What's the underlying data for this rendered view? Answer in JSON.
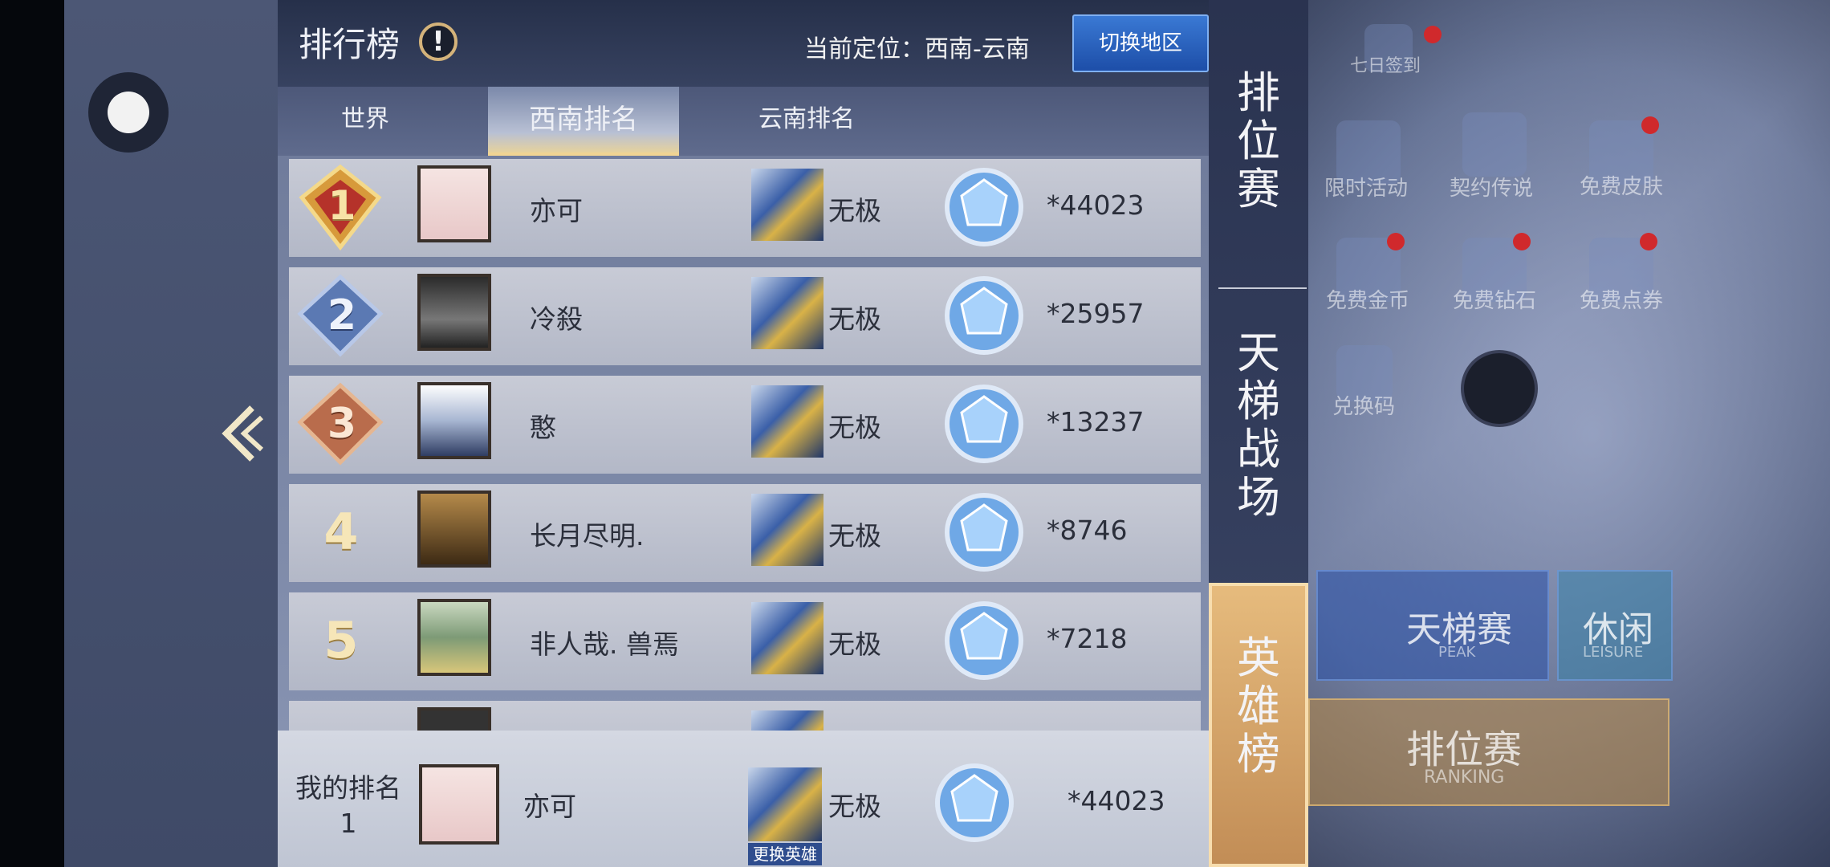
{
  "header": {
    "title": "排行榜",
    "location": "当前定位：西南-云南",
    "switch_region": "切换地区"
  },
  "tabs": [
    "世界",
    "西南排名",
    "云南排名"
  ],
  "active_tab": 1,
  "rows": [
    {
      "rank": "1",
      "name": "亦可",
      "hero": "无极",
      "score": "*44023"
    },
    {
      "rank": "2",
      "name": "冷殺",
      "hero": "无极",
      "score": "*25957"
    },
    {
      "rank": "3",
      "name": "憨",
      "hero": "无极",
      "score": "*13237"
    },
    {
      "rank": "4",
      "name": "长月尽明.",
      "hero": "无极",
      "score": "*8746"
    },
    {
      "rank": "5",
      "name": "非人哉. 兽焉",
      "hero": "无极",
      "score": "*7218"
    }
  ],
  "mine": {
    "label": "我的排名",
    "rank": "1",
    "name": "亦可",
    "hero": "无极",
    "change_hero": "更换英雄",
    "score": "*44023"
  },
  "categories": [
    "排位赛",
    "天梯战场",
    "英雄榜"
  ],
  "active_category": 2,
  "background_menu": {
    "top": [
      "七日签到"
    ],
    "icons": [
      "限时活动",
      "契约传说",
      "免费皮肤",
      "免费金币",
      "免费钻石",
      "免费点券",
      "兑换码"
    ],
    "modes": [
      {
        "label": "天梯赛",
        "sub": "PEAK"
      },
      {
        "label": "休闲",
        "sub": "LEISURE"
      },
      {
        "label": "排位赛",
        "sub": "RANKING"
      }
    ]
  },
  "colors": {
    "accent_gold": "#e6bb7d",
    "switch_blue": "#2f6bc6",
    "badge_gold": "#d79a3b",
    "badge_blue": "#5b79b3",
    "badge_bronze": "#b96c4c"
  },
  "icons": [
    "home-icon",
    "back-chevron-icon",
    "info-icon",
    "gem-icon",
    "hero-portrait-icon",
    "avatar-icon"
  ]
}
